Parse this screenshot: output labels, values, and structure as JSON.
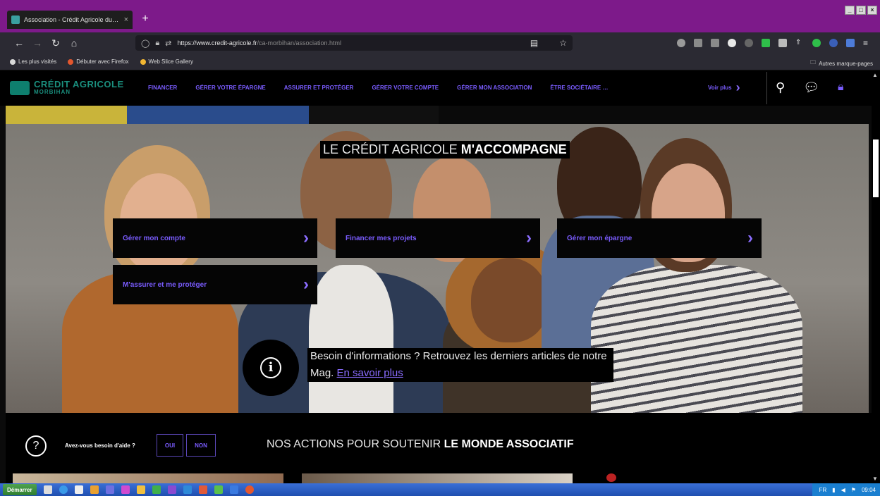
{
  "browser": {
    "tab_title": "Association - Crédit Agricole du M…",
    "tab_close": "×",
    "new_tab": "+",
    "url_domain": "https://www.credit-agricole.fr",
    "url_path": "/ca-morbihan/association.html",
    "bookmarks": [
      {
        "label": "Les plus visités",
        "color": "#d8d8d8"
      },
      {
        "label": "Débuter avec Firefox",
        "color": "#e4572e"
      },
      {
        "label": "Web Slice Gallery",
        "color": "#f2b632"
      }
    ],
    "other_bookmarks": "Autres marque-pages"
  },
  "site": {
    "logo_name": "CRÉDIT AGRICOLE",
    "logo_region": "MORBIHAN",
    "nav": [
      "FINANCER",
      "GÉRER VOTRE ÉPARGNE",
      "ASSURER ET PROTÉGER",
      "GÉRER VOTRE COMPTE",
      "GÉRER MON ASSOCIATION",
      "ÊTRE SOCIÉTAIRE …"
    ],
    "voir_plus": "Voir plus",
    "accent_color": "#7a5cff",
    "brand_color": "#0e7f6e"
  },
  "hero": {
    "title_light": "LE CRÉDIT AGRICOLE ",
    "title_bold": "M'ACCOMPAGNE",
    "cards": [
      "Gérer mon compte",
      "Financer mes projets",
      "Gérer mon épargne",
      "M'assurer et me protéger"
    ],
    "info_text": "Besoin d'informations ? Retrouvez les derniers articles de notre Mag.",
    "info_link": "En savoir plus"
  },
  "help": {
    "question": "Avez-vous besoin d'aide ?",
    "yes": "OUI",
    "no": "NON"
  },
  "section": {
    "title_light": "NOS ACTIONS POUR SOUTENIR ",
    "title_bold": "LE MONDE ASSOCIATIF"
  },
  "taskbar": {
    "start": "Démarrer",
    "lang": "FR",
    "time": "09:04"
  }
}
